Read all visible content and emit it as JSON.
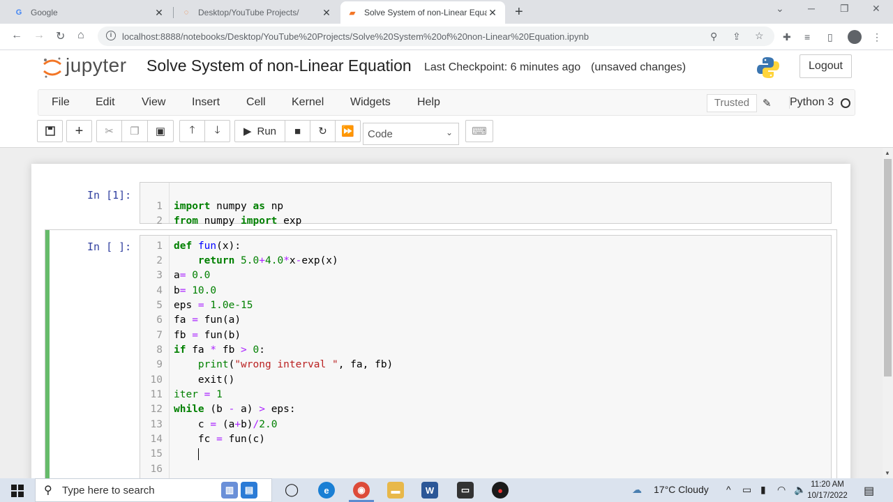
{
  "browser": {
    "tabs": [
      {
        "title": "Google"
      },
      {
        "title": "Desktop/YouTube Projects/"
      },
      {
        "title": "Solve System of non-Linear Equa"
      }
    ],
    "url": "localhost:8888/notebooks/Desktop/YouTube%20Projects/Solve%20System%20of%20non-Linear%20Equation.ipynb"
  },
  "jupyter": {
    "logo_text": "jupyter",
    "notebook_title": "Solve System of non-Linear Equation",
    "checkpoint": "Last Checkpoint: 6 minutes ago",
    "unsaved": "(unsaved changes)",
    "logout_label": "Logout",
    "menu": [
      "File",
      "Edit",
      "View",
      "Insert",
      "Cell",
      "Kernel",
      "Widgets",
      "Help"
    ],
    "trusted_label": "Trusted",
    "kernel_name": "Python 3",
    "run_label": "Run",
    "cell_type": "Code"
  },
  "cells": [
    {
      "prompt": "In [1]:",
      "lines": [
        "1",
        "2"
      ]
    },
    {
      "prompt": "In [ ]:",
      "lines": [
        "1",
        "2",
        "3",
        "4",
        "5",
        "6",
        "7",
        "8",
        "9",
        "10",
        "11",
        "12",
        "13",
        "14",
        "15",
        "16"
      ]
    }
  ],
  "taskbar": {
    "search_placeholder": "Type here to search",
    "weather": "17°C  Cloudy",
    "time": "11:20 AM",
    "date": "10/17/2022"
  },
  "colors": {
    "keyword": "#008000",
    "number": "#008000",
    "string": "#ba2121",
    "operator": "#aa22ff",
    "prompt": "#303f9f",
    "selected_cell_bar": "#66bb6a"
  }
}
